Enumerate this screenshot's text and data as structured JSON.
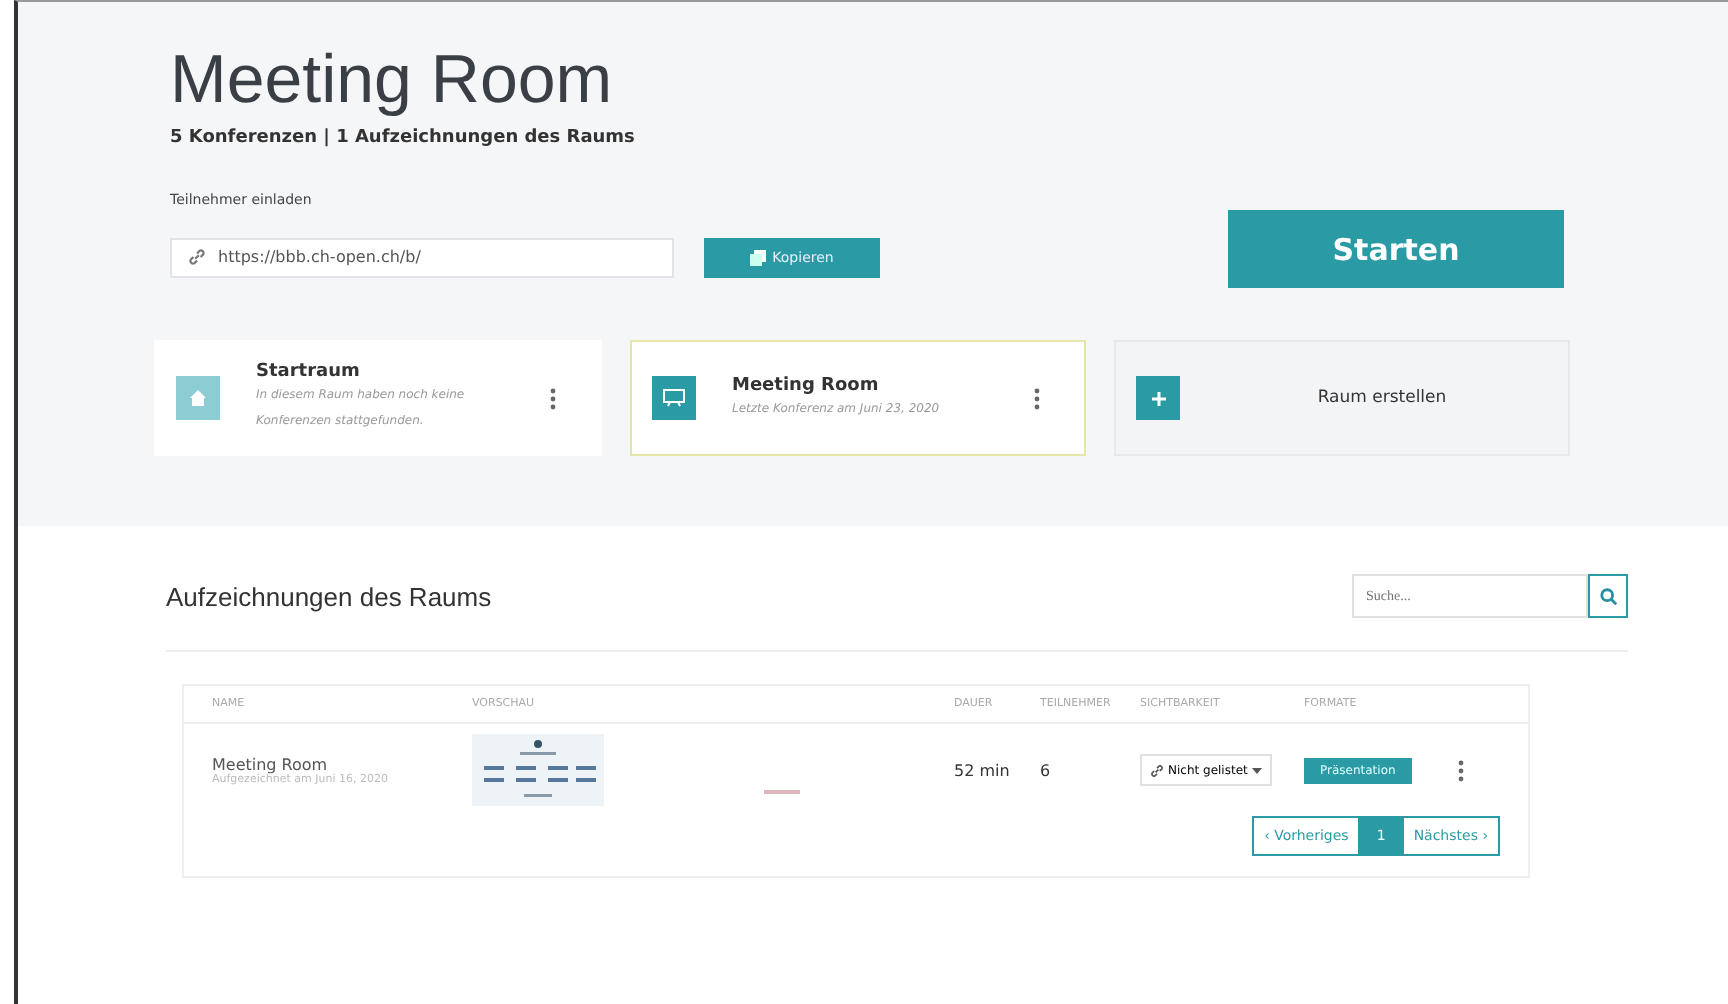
{
  "room": {
    "title": "Meeting Room",
    "subtitle": "5 Konferenzen | 1 Aufzeichnungen des Raums"
  },
  "invite": {
    "label": "Teilnehmer einladen",
    "url": "https://bbb.ch-open.ch/b/",
    "copy_button": "Kopieren"
  },
  "start_button": "Starten",
  "rooms": [
    {
      "kind": "home",
      "name": "Startraum",
      "info": "In diesem Raum haben noch keine Konferenzen stattgefunden.",
      "selected": false
    },
    {
      "kind": "meeting",
      "name": "Meeting Room",
      "info": "Letzte Konferenz am Juni 23, 2020",
      "selected": true
    },
    {
      "kind": "create",
      "name": "Raum erstellen",
      "selected": false
    }
  ],
  "recordings": {
    "title": "Aufzeichnungen des Raums",
    "search": {
      "placeholder": "Suche..."
    },
    "columns": [
      "NAME",
      "VORSCHAU",
      "DAUER",
      "TEILNEHMER",
      "SICHTBARKEIT",
      "FORMATE"
    ],
    "rows": [
      {
        "name": "Meeting Room",
        "date": "Aufgezeichnet am Juni 16, 2020",
        "duration": "52 min",
        "participants": "6",
        "visibility": "Nicht gelistet",
        "format": "Präsentation"
      }
    ],
    "pagination": [
      {
        "label": "‹ Vorheriges",
        "selected": false
      },
      {
        "label": "1",
        "selected": true
      },
      {
        "label": "Nächstes ›",
        "selected": false
      }
    ]
  }
}
